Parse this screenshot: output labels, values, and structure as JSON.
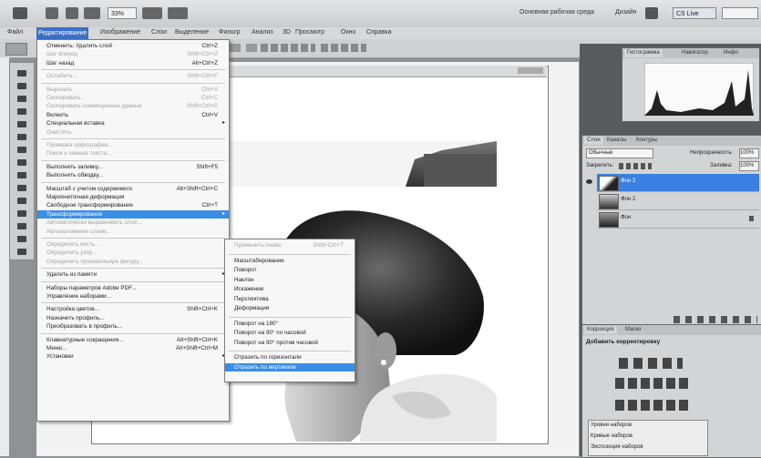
{
  "colors": {
    "accent": "#3a8ee6",
    "selected_layer": "#3b7fe0",
    "menu_bg": "#f7f7f7"
  },
  "topbar": {
    "zoom": "33%",
    "workspace_main": "Основная рабочая среда",
    "workspace_design": "Дизайн",
    "live": "CS Live"
  },
  "menubar": {
    "items": [
      "Файл",
      "Редактирование",
      "Изображение",
      "Слои",
      "Выделение",
      "Фильтр",
      "Анализ",
      "3D",
      "Просмотр",
      "Окно",
      "Справка"
    ]
  },
  "edit_menu": {
    "items": [
      {
        "label": "Отменить: Удалить слой",
        "shortcut": "Ctrl+Z"
      },
      {
        "label": "Шаг вперед",
        "shortcut": "Shift+Ctrl+Z",
        "disabled": true
      },
      {
        "label": "Шаг назад",
        "shortcut": "Alt+Ctrl+Z"
      },
      {
        "sep": true
      },
      {
        "label": "Ослабить...",
        "shortcut": "Shift+Ctrl+F",
        "disabled": true
      },
      {
        "sep": true
      },
      {
        "label": "Вырезать",
        "shortcut": "Ctrl+X",
        "disabled": true
      },
      {
        "label": "Скопировать",
        "shortcut": "Ctrl+C",
        "disabled": true
      },
      {
        "label": "Скопировать совмещенные данные",
        "shortcut": "Shift+Ctrl+C",
        "disabled": true
      },
      {
        "label": "Вклеить",
        "shortcut": "Ctrl+V"
      },
      {
        "label": "Специальная вставка",
        "submenu": true
      },
      {
        "label": "Очистить",
        "disabled": true
      },
      {
        "sep": true
      },
      {
        "label": "Проверка орфографии...",
        "disabled": true
      },
      {
        "label": "Поиск и замена текста...",
        "disabled": true
      },
      {
        "sep": true
      },
      {
        "label": "Выполнить заливку...",
        "shortcut": "Shift+F5"
      },
      {
        "label": "Выполнить обводку..."
      },
      {
        "sep": true
      },
      {
        "label": "Масштаб с учетом содержимого",
        "shortcut": "Alt+Shift+Ctrl+C"
      },
      {
        "label": "Марионеточная деформация"
      },
      {
        "label": "Свободное трансформирование",
        "shortcut": "Ctrl+T"
      },
      {
        "label": "Трансформирование",
        "submenu": true,
        "highlight": true
      },
      {
        "label": "Автоматически выравнивать слои...",
        "disabled": true
      },
      {
        "label": "Автоналожение слоев...",
        "disabled": true
      },
      {
        "sep": true
      },
      {
        "label": "Определить кисть...",
        "disabled": true
      },
      {
        "label": "Определить узор...",
        "disabled": true
      },
      {
        "label": "Определить произвольную фигуру...",
        "disabled": true
      },
      {
        "sep": true
      },
      {
        "label": "Удалить из памяти",
        "submenu": true
      },
      {
        "sep": true
      },
      {
        "label": "Наборы параметров Adobe PDF..."
      },
      {
        "label": "Управление наборами..."
      },
      {
        "sep": true
      },
      {
        "label": "Настройка цветов...",
        "shortcut": "Shift+Ctrl+K"
      },
      {
        "label": "Назначить профиль..."
      },
      {
        "label": "Преобразовать в профиль..."
      },
      {
        "sep": true
      },
      {
        "label": "Клавиатурные сокращения...",
        "shortcut": "Alt+Shift+Ctrl+K"
      },
      {
        "label": "Меню...",
        "shortcut": "Alt+Shift+Ctrl+M"
      },
      {
        "label": "Установки",
        "submenu": true
      }
    ]
  },
  "transform_menu": {
    "items": [
      {
        "label": "Применить снова",
        "shortcut": "Shift+Ctrl+T",
        "disabled": true
      },
      {
        "sep": true
      },
      {
        "label": "Масштабирование"
      },
      {
        "label": "Поворот"
      },
      {
        "label": "Наклон"
      },
      {
        "label": "Искажение"
      },
      {
        "label": "Перспектива"
      },
      {
        "label": "Деформация"
      },
      {
        "sep": true
      },
      {
        "label": "Поворот на 180°"
      },
      {
        "label": "Поворот на 90° по часовой"
      },
      {
        "label": "Поворот на 90° против часовой"
      },
      {
        "sep": true
      },
      {
        "label": "Отразить по горизонтали"
      },
      {
        "label": "Отразить по вертикали",
        "highlight": true
      }
    ]
  },
  "histogram_panel": {
    "tabs": [
      "Гистограмма",
      "Навигатор",
      "Инфо"
    ]
  },
  "layers_panel": {
    "tabs": [
      "Слои",
      "Каналы",
      "Контуры"
    ],
    "blend_mode": "Обычные",
    "opacity_label": "Непрозрачность:",
    "opacity": "100%",
    "lock_label": "Закрепить:",
    "fill_label": "Заливка:",
    "fill": "100%",
    "layers": [
      {
        "name": "Фон 2",
        "selected": true
      },
      {
        "name": "Фон 2"
      },
      {
        "name": "Фон"
      }
    ]
  },
  "adjustments_panel": {
    "tabs": [
      "Коррекция",
      "Маски"
    ],
    "title": "Добавить корректировку",
    "presets": [
      "Уровни наборов",
      "Кривые наборов",
      "Экспозиция наборов"
    ]
  }
}
